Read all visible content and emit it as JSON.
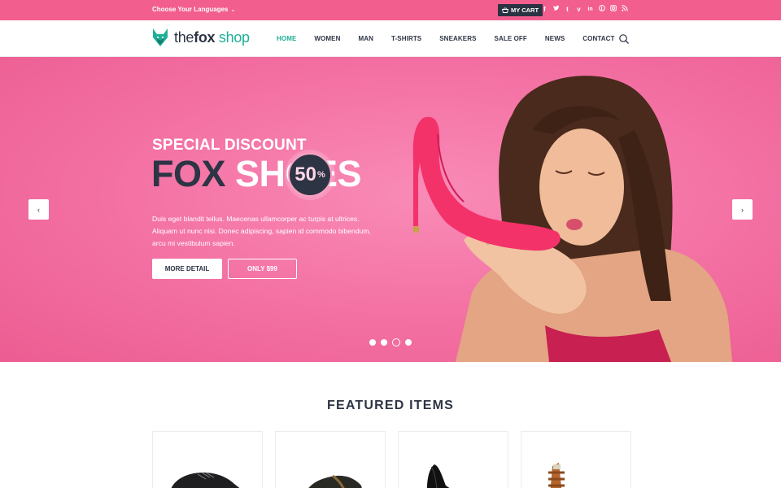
{
  "topbar": {
    "language_label": "Choose Your Languages",
    "cart_label": "MY CART",
    "social_icons": [
      "facebook-icon",
      "twitter-icon",
      "tumblr-icon",
      "vimeo-icon",
      "linkedin-icon",
      "pinterest-icon",
      "instagram-icon",
      "rss-icon"
    ]
  },
  "header": {
    "logo": {
      "part1": "the",
      "part2": "fox",
      "part3": " shop"
    },
    "nav": [
      "HOME",
      "WOMEN",
      "MAN",
      "T-SHIRTS",
      "SNEAKERS",
      "SALE OFF",
      "NEWS",
      "CONTACT"
    ],
    "active_nav": "HOME"
  },
  "hero": {
    "subtitle": "SPECIAL DISCOUNT",
    "title_dark": "FOX",
    "title_light": "SHOES",
    "badge_value": "50",
    "badge_unit": "%",
    "text": "Duis eget blandit tellus. Maecenas ullamcorper ac turpis at ultrices. Aliquam ut nunc nisi. Donec adipiscing, sapien id commodo bibendum, arcu mi vestibulum sapien.",
    "button_primary": "MORE DETAIL",
    "button_secondary": "ONLY $99",
    "slides": 4,
    "active_slide": 3
  },
  "featured": {
    "title": "FEATURED ITEMS",
    "items": [
      "item-1",
      "item-2",
      "item-3",
      "item-4"
    ]
  },
  "colors": {
    "brand_pink": "#f25e8e",
    "accent_teal": "#1fb097",
    "dark_navy": "#2d3444"
  }
}
